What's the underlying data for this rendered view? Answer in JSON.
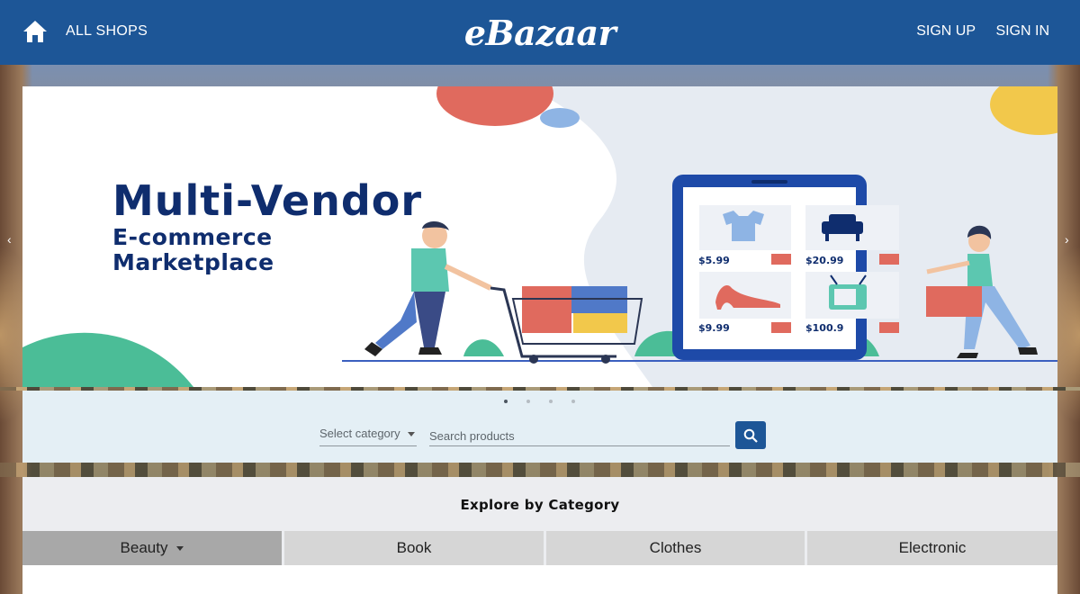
{
  "header": {
    "all_shops": "ALL SHOPS",
    "logo": "eBazaar",
    "sign_up": "SIGN UP",
    "sign_in": "SIGN IN",
    "home_icon": "home-icon",
    "background": "#1d5697"
  },
  "banner": {
    "title": "Multi-Vendor",
    "subtitle_line1": "E-commerce",
    "subtitle_line2": "Marketplace",
    "prices": [
      "$5.99",
      "$20.99",
      "$9.99",
      "$100.9"
    ],
    "product_icons": [
      "tshirt-icon",
      "armchair-icon",
      "high-heel-icon",
      "tv-icon"
    ]
  },
  "carousel": {
    "slide_count": 4,
    "active_slide": 1
  },
  "search": {
    "category_placeholder": "Select category",
    "search_placeholder": "Search products",
    "search_icon": "search-icon"
  },
  "explore": {
    "title": "Explore by Category",
    "categories": [
      "Beauty",
      "Book",
      "Clothes",
      "Electronic"
    ],
    "active_category": "Beauty"
  },
  "colors": {
    "primary": "#1d5697",
    "navy_text": "#0f2d6e",
    "panel_bg": "#e4eff5",
    "explore_bg": "#ecedf0"
  }
}
